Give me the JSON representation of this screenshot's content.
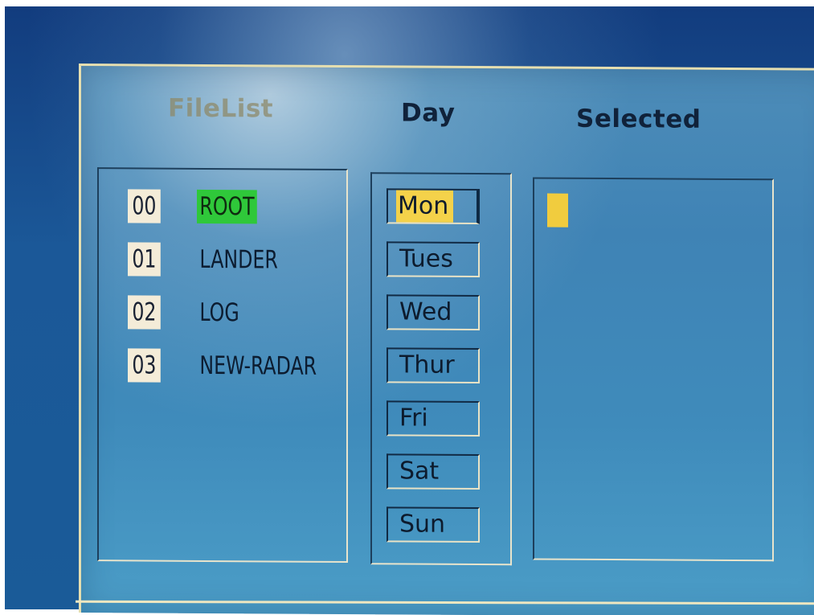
{
  "columns": {
    "filelist_title": "FileList",
    "day_title": "Day",
    "selected_title": "Selected"
  },
  "files": [
    {
      "num": "00",
      "name": "ROOT",
      "active": true
    },
    {
      "num": "01",
      "name": "LANDER",
      "active": false
    },
    {
      "num": "02",
      "name": "LOG",
      "active": false
    },
    {
      "num": "03",
      "name": "NEW-RADAR",
      "active": false
    }
  ],
  "days": [
    {
      "label": "Mon",
      "active": true
    },
    {
      "label": "Tues",
      "active": false
    },
    {
      "label": "Wed",
      "active": false
    },
    {
      "label": "Thur",
      "active": false
    },
    {
      "label": "Fri",
      "active": false
    },
    {
      "label": "Sat",
      "active": false
    },
    {
      "label": "Sun",
      "active": false
    }
  ],
  "colors": {
    "screen_blue": "#1b5898",
    "dialog_blue": "#3f83b5",
    "highlight_green": "#2fc83a",
    "highlight_yellow": "#f4d24a",
    "number_bg": "#f4ecd8"
  }
}
